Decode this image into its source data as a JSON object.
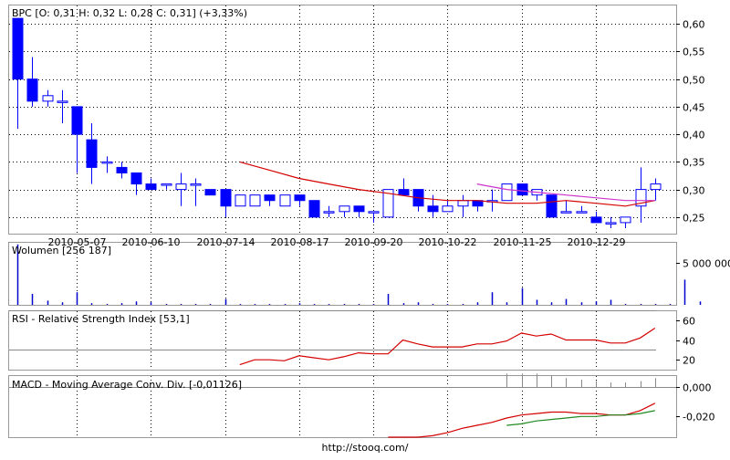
{
  "chart_data": [
    {
      "type": "candlestick",
      "title": "BPC [O: 0,31  H: 0,32  L: 0,28  C: 0,31] (+3,33%)",
      "ylim": [
        0.22,
        0.635
      ],
      "y_ticks": [
        0.25,
        0.3,
        0.35,
        0.4,
        0.45,
        0.5,
        0.55,
        0.6
      ],
      "y_tick_labels": [
        "0,25",
        "0,30",
        "0,35",
        "0,40",
        "0,45",
        "0,50",
        "0,55",
        "0,60"
      ],
      "x_tick_labels": [
        "2010-05-07",
        "2010-06-10",
        "2010-07-14",
        "2010-08-17",
        "2010-09-20",
        "2010-10-22",
        "2010-11-25",
        "2010-12-29"
      ],
      "x_tick_index": [
        4,
        9,
        14,
        19,
        24,
        29,
        34,
        39
      ],
      "grid": true,
      "colors": {
        "down": "#0000ff",
        "up_fill": "#ffffff",
        "up_stroke": "#0000ff",
        "ma_long": "#d40000",
        "ma_short": "#cc33cc"
      },
      "candles": [
        {
          "o": 0.61,
          "h": 0.61,
          "l": 0.41,
          "c": 0.5
        },
        {
          "o": 0.5,
          "h": 0.54,
          "l": 0.45,
          "c": 0.46
        },
        {
          "o": 0.46,
          "h": 0.48,
          "l": 0.45,
          "c": 0.47
        },
        {
          "o": 0.46,
          "h": 0.48,
          "l": 0.42,
          "c": 0.46
        },
        {
          "o": 0.45,
          "h": 0.45,
          "l": 0.33,
          "c": 0.4
        },
        {
          "o": 0.39,
          "h": 0.42,
          "l": 0.31,
          "c": 0.34
        },
        {
          "o": 0.35,
          "h": 0.36,
          "l": 0.33,
          "c": 0.35
        },
        {
          "o": 0.34,
          "h": 0.35,
          "l": 0.32,
          "c": 0.33
        },
        {
          "o": 0.33,
          "h": 0.33,
          "l": 0.29,
          "c": 0.31
        },
        {
          "o": 0.31,
          "h": 0.32,
          "l": 0.3,
          "c": 0.3
        },
        {
          "o": 0.31,
          "h": 0.31,
          "l": 0.3,
          "c": 0.31
        },
        {
          "o": 0.3,
          "h": 0.33,
          "l": 0.27,
          "c": 0.31
        },
        {
          "o": 0.31,
          "h": 0.32,
          "l": 0.27,
          "c": 0.31
        },
        {
          "o": 0.3,
          "h": 0.3,
          "l": 0.29,
          "c": 0.29
        },
        {
          "o": 0.3,
          "h": 0.3,
          "l": 0.25,
          "c": 0.27
        },
        {
          "o": 0.27,
          "h": 0.29,
          "l": 0.27,
          "c": 0.29
        },
        {
          "o": 0.27,
          "h": 0.29,
          "l": 0.27,
          "c": 0.29
        },
        {
          "o": 0.29,
          "h": 0.29,
          "l": 0.27,
          "c": 0.28
        },
        {
          "o": 0.27,
          "h": 0.29,
          "l": 0.27,
          "c": 0.29
        },
        {
          "o": 0.29,
          "h": 0.29,
          "l": 0.27,
          "c": 0.28
        },
        {
          "o": 0.28,
          "h": 0.28,
          "l": 0.25,
          "c": 0.25
        },
        {
          "o": 0.26,
          "h": 0.27,
          "l": 0.25,
          "c": 0.26
        },
        {
          "o": 0.26,
          "h": 0.27,
          "l": 0.25,
          "c": 0.27
        },
        {
          "o": 0.27,
          "h": 0.27,
          "l": 0.25,
          "c": 0.26
        },
        {
          "o": 0.26,
          "h": 0.26,
          "l": 0.24,
          "c": 0.26
        },
        {
          "o": 0.25,
          "h": 0.3,
          "l": 0.25,
          "c": 0.3
        },
        {
          "o": 0.3,
          "h": 0.32,
          "l": 0.29,
          "c": 0.29
        },
        {
          "o": 0.3,
          "h": 0.3,
          "l": 0.26,
          "c": 0.27
        },
        {
          "o": 0.27,
          "h": 0.29,
          "l": 0.25,
          "c": 0.26
        },
        {
          "o": 0.26,
          "h": 0.28,
          "l": 0.26,
          "c": 0.27
        },
        {
          "o": 0.27,
          "h": 0.29,
          "l": 0.25,
          "c": 0.28
        },
        {
          "o": 0.28,
          "h": 0.28,
          "l": 0.26,
          "c": 0.27
        },
        {
          "o": 0.28,
          "h": 0.3,
          "l": 0.26,
          "c": 0.28
        },
        {
          "o": 0.28,
          "h": 0.31,
          "l": 0.28,
          "c": 0.31
        },
        {
          "o": 0.31,
          "h": 0.31,
          "l": 0.29,
          "c": 0.29
        },
        {
          "o": 0.29,
          "h": 0.3,
          "l": 0.28,
          "c": 0.3
        },
        {
          "o": 0.29,
          "h": 0.29,
          "l": 0.25,
          "c": 0.25
        },
        {
          "o": 0.26,
          "h": 0.28,
          "l": 0.26,
          "c": 0.26
        },
        {
          "o": 0.26,
          "h": 0.27,
          "l": 0.26,
          "c": 0.26
        },
        {
          "o": 0.25,
          "h": 0.26,
          "l": 0.24,
          "c": 0.24
        },
        {
          "o": 0.24,
          "h": 0.25,
          "l": 0.23,
          "c": 0.24
        },
        {
          "o": 0.24,
          "h": 0.25,
          "l": 0.23,
          "c": 0.25
        },
        {
          "o": 0.27,
          "h": 0.34,
          "l": 0.24,
          "c": 0.3
        },
        {
          "o": 0.3,
          "h": 0.32,
          "l": 0.28,
          "c": 0.31
        }
      ],
      "ma_long": [
        [
          15,
          0.35
        ],
        [
          17,
          0.335
        ],
        [
          19,
          0.32
        ],
        [
          21,
          0.31
        ],
        [
          23,
          0.3
        ],
        [
          25,
          0.293
        ],
        [
          27,
          0.285
        ],
        [
          29,
          0.28
        ],
        [
          31,
          0.28
        ],
        [
          33,
          0.275
        ],
        [
          35,
          0.275
        ],
        [
          37,
          0.28
        ],
        [
          39,
          0.275
        ],
        [
          41,
          0.27
        ],
        [
          43,
          0.28
        ]
      ],
      "ma_short": [
        [
          31,
          0.31
        ],
        [
          33,
          0.3
        ],
        [
          35,
          0.295
        ],
        [
          37,
          0.29
        ],
        [
          39,
          0.285
        ],
        [
          41,
          0.28
        ],
        [
          43,
          0.28
        ]
      ]
    },
    {
      "type": "bar",
      "title": "Wolumen [256 187]",
      "ylim": [
        0,
        7500000
      ],
      "y_ticks": [
        5000000
      ],
      "y_tick_labels": [
        "5 000 000"
      ],
      "color": "#0000cc",
      "values": [
        7200000,
        1300000,
        500000,
        300000,
        1500000,
        200000,
        100000,
        200000,
        400000,
        300000,
        100000,
        100000,
        100000,
        100000,
        700000,
        100000,
        100000,
        100000,
        100000,
        200000,
        100000,
        100000,
        100000,
        100000,
        100000,
        1300000,
        200000,
        300000,
        100000,
        100000,
        100000,
        300000,
        1500000,
        300000,
        2000000,
        600000,
        300000,
        700000,
        300000,
        400000,
        600000,
        100000,
        100000,
        100000,
        100000,
        3000000,
        400000
      ]
    },
    {
      "type": "line",
      "title": "RSI - Relative Strength Index [53,1]",
      "ylim": [
        10,
        70
      ],
      "y_ticks": [
        20,
        40,
        60
      ],
      "y_tick_labels": [
        "20",
        "40",
        "60"
      ],
      "ref_lines": [
        30,
        70
      ],
      "color": "#d40000",
      "x": [
        15,
        16,
        17,
        18,
        19,
        20,
        21,
        22,
        23,
        24,
        25,
        26,
        27,
        28,
        29,
        30,
        31,
        32,
        33,
        34,
        35,
        36,
        37,
        38,
        39,
        40,
        41,
        42,
        43
      ],
      "values": [
        15,
        20,
        20,
        19,
        24,
        22,
        20,
        23,
        27,
        26,
        26,
        40,
        36,
        33,
        33,
        33,
        36,
        36,
        39,
        47,
        44,
        46,
        40,
        40,
        40,
        37,
        37,
        42,
        52
      ]
    },
    {
      "type": "line",
      "title": "MACD - Moving Average Conv. Div. [-0,01126]",
      "ylim": [
        -0.034,
        0.008
      ],
      "y_ticks": [
        0.0,
        -0.02
      ],
      "y_tick_labels": [
        "0,000",
        "-0,020"
      ],
      "ref_lines": [
        0.0
      ],
      "series": [
        {
          "color": "#d40000",
          "x": [
            25,
            26,
            27,
            28,
            29,
            30,
            31,
            32,
            33,
            34,
            35,
            36,
            37,
            38,
            39,
            40,
            41,
            42,
            43
          ],
          "values": [
            -0.042,
            -0.039,
            -0.036,
            -0.033,
            -0.031,
            -0.028,
            -0.026,
            -0.024,
            -0.021,
            -0.019,
            -0.018,
            -0.017,
            -0.017,
            -0.018,
            -0.018,
            -0.019,
            -0.019,
            -0.016,
            -0.011
          ]
        },
        {
          "color": "#228822",
          "x": [
            33,
            34,
            35,
            36,
            37,
            38,
            39,
            40,
            41,
            42,
            43
          ],
          "values": [
            -0.026,
            -0.025,
            -0.023,
            -0.022,
            -0.021,
            -0.02,
            -0.02,
            -0.019,
            -0.019,
            -0.018,
            -0.016
          ]
        }
      ],
      "histogram": {
        "x": [
          33,
          34,
          35,
          36,
          37,
          38,
          39,
          40,
          41,
          42,
          43
        ],
        "values": [
          0.009,
          0.009,
          0.009,
          0.008,
          0.006,
          0.005,
          0.004,
          0.003,
          0.003,
          0.004,
          0.006
        ]
      }
    }
  ],
  "footer": "http://stooq.com/"
}
